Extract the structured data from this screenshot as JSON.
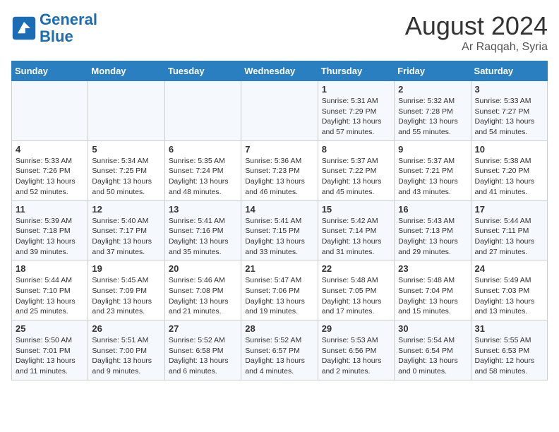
{
  "header": {
    "logo_line1": "General",
    "logo_line2": "Blue",
    "month_year": "August 2024",
    "location": "Ar Raqqah, Syria"
  },
  "weekdays": [
    "Sunday",
    "Monday",
    "Tuesday",
    "Wednesday",
    "Thursday",
    "Friday",
    "Saturday"
  ],
  "weeks": [
    [
      {
        "day": "",
        "info": ""
      },
      {
        "day": "",
        "info": ""
      },
      {
        "day": "",
        "info": ""
      },
      {
        "day": "",
        "info": ""
      },
      {
        "day": "1",
        "info": "Sunrise: 5:31 AM\nSunset: 7:29 PM\nDaylight: 13 hours\nand 57 minutes."
      },
      {
        "day": "2",
        "info": "Sunrise: 5:32 AM\nSunset: 7:28 PM\nDaylight: 13 hours\nand 55 minutes."
      },
      {
        "day": "3",
        "info": "Sunrise: 5:33 AM\nSunset: 7:27 PM\nDaylight: 13 hours\nand 54 minutes."
      }
    ],
    [
      {
        "day": "4",
        "info": "Sunrise: 5:33 AM\nSunset: 7:26 PM\nDaylight: 13 hours\nand 52 minutes."
      },
      {
        "day": "5",
        "info": "Sunrise: 5:34 AM\nSunset: 7:25 PM\nDaylight: 13 hours\nand 50 minutes."
      },
      {
        "day": "6",
        "info": "Sunrise: 5:35 AM\nSunset: 7:24 PM\nDaylight: 13 hours\nand 48 minutes."
      },
      {
        "day": "7",
        "info": "Sunrise: 5:36 AM\nSunset: 7:23 PM\nDaylight: 13 hours\nand 46 minutes."
      },
      {
        "day": "8",
        "info": "Sunrise: 5:37 AM\nSunset: 7:22 PM\nDaylight: 13 hours\nand 45 minutes."
      },
      {
        "day": "9",
        "info": "Sunrise: 5:37 AM\nSunset: 7:21 PM\nDaylight: 13 hours\nand 43 minutes."
      },
      {
        "day": "10",
        "info": "Sunrise: 5:38 AM\nSunset: 7:20 PM\nDaylight: 13 hours\nand 41 minutes."
      }
    ],
    [
      {
        "day": "11",
        "info": "Sunrise: 5:39 AM\nSunset: 7:18 PM\nDaylight: 13 hours\nand 39 minutes."
      },
      {
        "day": "12",
        "info": "Sunrise: 5:40 AM\nSunset: 7:17 PM\nDaylight: 13 hours\nand 37 minutes."
      },
      {
        "day": "13",
        "info": "Sunrise: 5:41 AM\nSunset: 7:16 PM\nDaylight: 13 hours\nand 35 minutes."
      },
      {
        "day": "14",
        "info": "Sunrise: 5:41 AM\nSunset: 7:15 PM\nDaylight: 13 hours\nand 33 minutes."
      },
      {
        "day": "15",
        "info": "Sunrise: 5:42 AM\nSunset: 7:14 PM\nDaylight: 13 hours\nand 31 minutes."
      },
      {
        "day": "16",
        "info": "Sunrise: 5:43 AM\nSunset: 7:13 PM\nDaylight: 13 hours\nand 29 minutes."
      },
      {
        "day": "17",
        "info": "Sunrise: 5:44 AM\nSunset: 7:11 PM\nDaylight: 13 hours\nand 27 minutes."
      }
    ],
    [
      {
        "day": "18",
        "info": "Sunrise: 5:44 AM\nSunset: 7:10 PM\nDaylight: 13 hours\nand 25 minutes."
      },
      {
        "day": "19",
        "info": "Sunrise: 5:45 AM\nSunset: 7:09 PM\nDaylight: 13 hours\nand 23 minutes."
      },
      {
        "day": "20",
        "info": "Sunrise: 5:46 AM\nSunset: 7:08 PM\nDaylight: 13 hours\nand 21 minutes."
      },
      {
        "day": "21",
        "info": "Sunrise: 5:47 AM\nSunset: 7:06 PM\nDaylight: 13 hours\nand 19 minutes."
      },
      {
        "day": "22",
        "info": "Sunrise: 5:48 AM\nSunset: 7:05 PM\nDaylight: 13 hours\nand 17 minutes."
      },
      {
        "day": "23",
        "info": "Sunrise: 5:48 AM\nSunset: 7:04 PM\nDaylight: 13 hours\nand 15 minutes."
      },
      {
        "day": "24",
        "info": "Sunrise: 5:49 AM\nSunset: 7:03 PM\nDaylight: 13 hours\nand 13 minutes."
      }
    ],
    [
      {
        "day": "25",
        "info": "Sunrise: 5:50 AM\nSunset: 7:01 PM\nDaylight: 13 hours\nand 11 minutes."
      },
      {
        "day": "26",
        "info": "Sunrise: 5:51 AM\nSunset: 7:00 PM\nDaylight: 13 hours\nand 9 minutes."
      },
      {
        "day": "27",
        "info": "Sunrise: 5:52 AM\nSunset: 6:58 PM\nDaylight: 13 hours\nand 6 minutes."
      },
      {
        "day": "28",
        "info": "Sunrise: 5:52 AM\nSunset: 6:57 PM\nDaylight: 13 hours\nand 4 minutes."
      },
      {
        "day": "29",
        "info": "Sunrise: 5:53 AM\nSunset: 6:56 PM\nDaylight: 13 hours\nand 2 minutes."
      },
      {
        "day": "30",
        "info": "Sunrise: 5:54 AM\nSunset: 6:54 PM\nDaylight: 13 hours\nand 0 minutes."
      },
      {
        "day": "31",
        "info": "Sunrise: 5:55 AM\nSunset: 6:53 PM\nDaylight: 12 hours\nand 58 minutes."
      }
    ]
  ]
}
